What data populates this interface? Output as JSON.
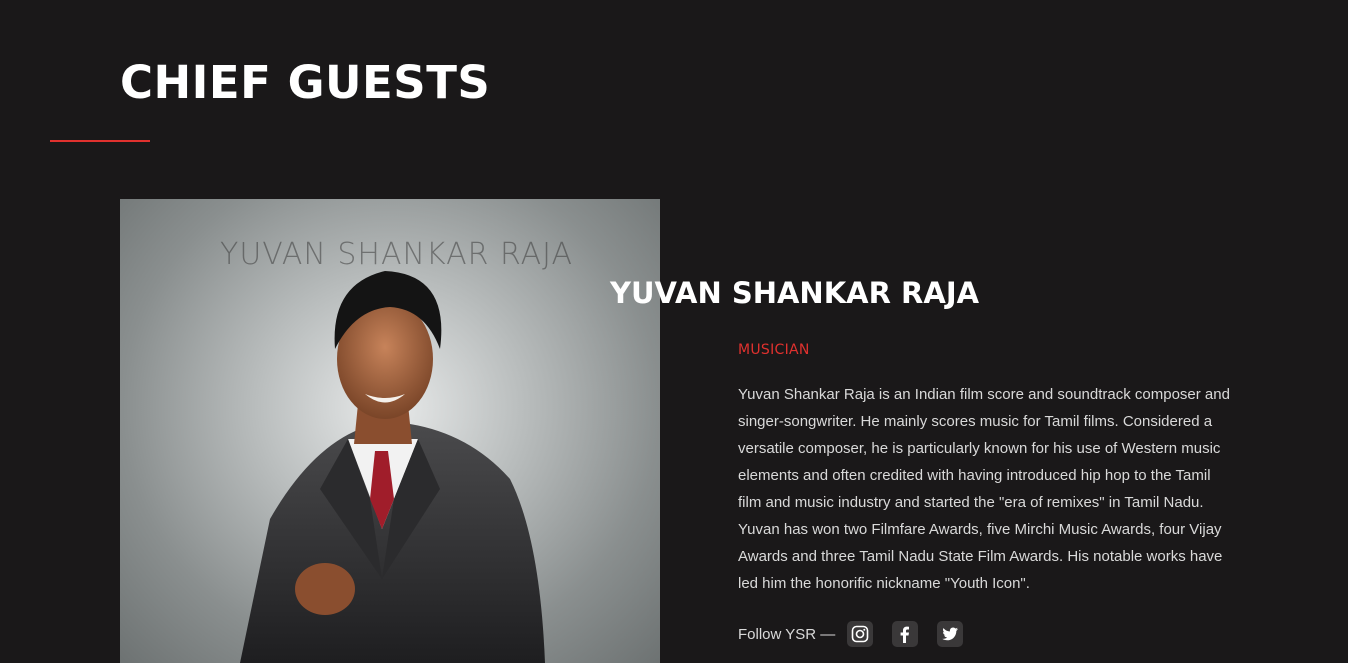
{
  "section": {
    "title": "CHIEF GUESTS"
  },
  "guest": {
    "photo_watermark": "YUVAN SHANKAR RAJA",
    "name": "YUVAN SHANKAR RAJA",
    "role": "MUSICIAN",
    "bio": "Yuvan Shankar Raja is an Indian film score and soundtrack composer and singer-songwriter. He mainly scores music for Tamil films. Considered a versatile composer, he is particularly known for his use of Western music elements and often credited with having introduced hip hop to the Tamil film and music industry and started the \"era of remixes\" in Tamil Nadu. Yuvan has won two Filmfare Awards, five Mirchi Music Awards, four Vijay Awards and three Tamil Nadu State Film Awards. His notable works have led him the honorific nickname \"Youth Icon\".",
    "follow_label": "Follow YSR —",
    "social": [
      {
        "icon": "instagram-icon"
      },
      {
        "icon": "facebook-icon"
      },
      {
        "icon": "twitter-icon"
      }
    ]
  },
  "colors": {
    "background": "#1a1819",
    "accent": "#e0312e",
    "text": "#ffffff",
    "muted_text": "#d9d9d9"
  }
}
